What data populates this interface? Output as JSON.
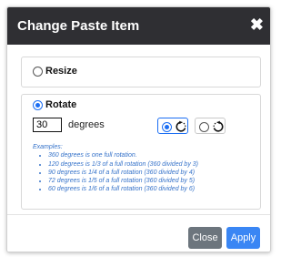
{
  "dialog": {
    "title": "Change Paste Item",
    "close_glyph": "✖"
  },
  "resize": {
    "label": "Resize",
    "selected": false
  },
  "rotate": {
    "label": "Rotate",
    "selected": true,
    "degrees_value": "30",
    "degrees_label": "degrees",
    "direction_options": [
      {
        "icon": "rotate-clockwise-icon",
        "selected": true
      },
      {
        "icon": "rotate-counterclockwise-icon",
        "selected": false
      }
    ],
    "examples_title": "Examples:",
    "examples": [
      "360 degrees is one full rotation.",
      "120 degrees is 1/3 of a full rotation (360 divided by 3)",
      "90 degrees is 1/4 of a full rotation (360 divided by 4)",
      "72 degrees is 1/5 of a full rotation (360 divided by 5)",
      "60 degrees is 1/6 of a full rotation (360 divided by 6)"
    ]
  },
  "footer": {
    "close_label": "Close",
    "apply_label": "Apply"
  },
  "colors": {
    "header_bg": "#2f2f33",
    "accent": "#1b6ef3",
    "apply_button": "#3a86f4",
    "close_button": "#6c757d",
    "examples_text": "#3572c9"
  }
}
